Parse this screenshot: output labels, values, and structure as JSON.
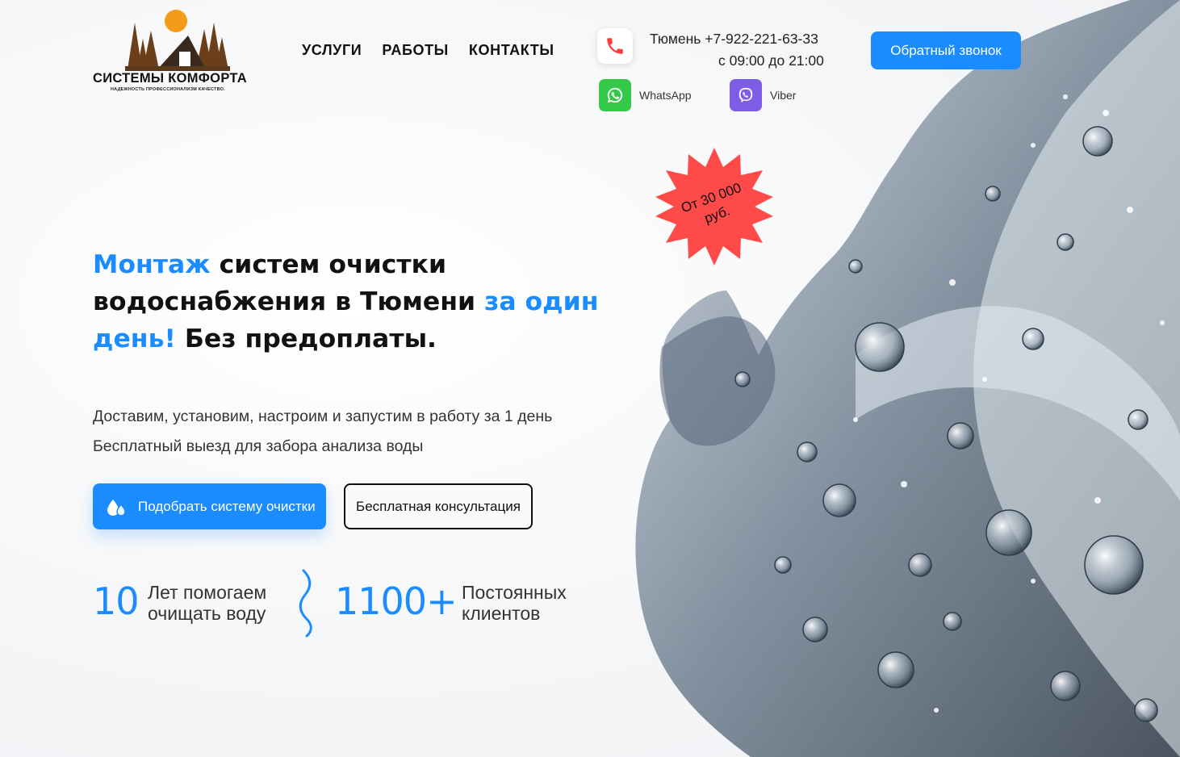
{
  "logo": {
    "title": "СИСТЕМЫ КОМФОРТА",
    "subtitle": "НАДЕЖНОСТЬ ПРОФЕССИОНАЛИЗМ КАЧЕСТВО."
  },
  "nav": {
    "items": [
      {
        "label": "УСЛУГИ"
      },
      {
        "label": "РАБОТЫ"
      },
      {
        "label": "КОНТАКТЫ"
      }
    ]
  },
  "contact": {
    "city_phone": "Тюмень +7-922-221-63-33",
    "hours": "с 09:00 до 21:00",
    "phone_icon": "phone-icon",
    "messengers": [
      {
        "label": "WhatsApp",
        "icon": "whatsapp-icon",
        "color": "#35c94a"
      },
      {
        "label": "Viber",
        "icon": "viber-icon",
        "color": "#7d5ce6"
      }
    ]
  },
  "header": {
    "callback_label": "Обратный звонок"
  },
  "badge": {
    "line1": "От 30 000",
    "line2": "руб.",
    "color": "#ff4a4a"
  },
  "hero": {
    "headline": {
      "part1_accent": "Монтаж",
      "part2": " систем очистки водоснабжения в Тюмени ",
      "part3_accent": "за один день!",
      "part4": " Без предоплаты."
    },
    "desc1": "Доставим, установим, настроим и запустим в работу за 1 день",
    "desc2": "Бесплатный выезд для забора анализа воды",
    "primary_button": "Подобрать систему очистки",
    "primary_icon": "water-drops-icon",
    "secondary_button": "Бесплатная консультация"
  },
  "stats": [
    {
      "value": "10",
      "label": "Лет помогаем очищать воду"
    },
    {
      "value": "1100+",
      "label": "Постоянных клиентов"
    }
  ],
  "colors": {
    "accent": "#1a8cff",
    "text": "#111111",
    "badge": "#ff4a4a"
  }
}
